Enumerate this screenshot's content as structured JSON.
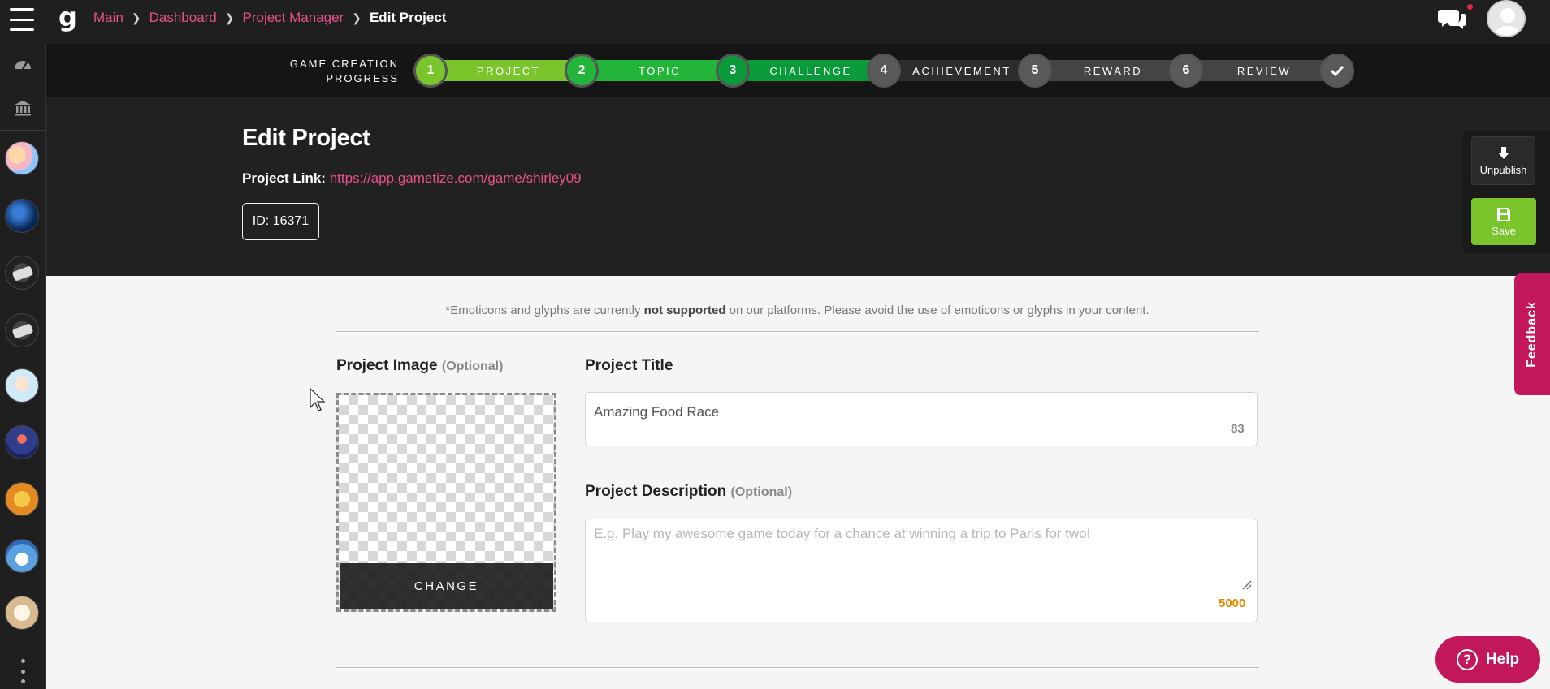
{
  "topnav": {
    "logo": "g",
    "breadcrumb": {
      "main": "Main",
      "dashboard": "Dashboard",
      "project_manager": "Project Manager",
      "current": "Edit Project"
    },
    "sep": ">"
  },
  "progress": {
    "title": "GAME CREATION PROGRESS",
    "steps": [
      {
        "num": "1",
        "label": "PROJECT",
        "color": "#7ac52b"
      },
      {
        "num": "2",
        "label": "TOPIC",
        "color": "#22b53a"
      },
      {
        "num": "3",
        "label": "CHALLENGE",
        "color": "#0a9a3a"
      },
      {
        "num": "4",
        "label": "ACHIEVEMENT",
        "color": "#444444"
      },
      {
        "num": "5",
        "label": "REWARD",
        "color": "#444444"
      },
      {
        "num": "6",
        "label": "REVIEW",
        "color": "#444444"
      }
    ],
    "final_icon": "check-icon"
  },
  "header": {
    "title": "Edit Project",
    "link_label": "Project Link:",
    "link_url": "https://app.gametize.com/game/shirley09",
    "id_label": "ID: 16371"
  },
  "actions": {
    "unpublish_label": "Unpublish",
    "save_label": "Save"
  },
  "feedback_label": "Feedback",
  "notice": {
    "before": "*Emoticons and glyphs are currently ",
    "bold": "not supported",
    "after": " on our platforms. Please avoid the use of emoticons or glyphs in your content."
  },
  "form": {
    "image_label": "Project Image",
    "image_optional": "(Optional)",
    "change_label": "CHANGE",
    "title_label": "Project Title",
    "title_value": "Amazing Food Race",
    "title_counter": "83",
    "desc_label": "Project Description",
    "desc_optional": "(Optional)",
    "desc_placeholder": "E.g. Play my awesome game today for a chance at winning a trip to Paris for two!",
    "desc_counter": "5000"
  },
  "help_label": "Help",
  "help_glyph": "?",
  "colors": {
    "accent_pink": "#e8528a",
    "save_green": "#7ac52b",
    "feedback": "#c2185b",
    "counter_orange": "#e08a00"
  }
}
